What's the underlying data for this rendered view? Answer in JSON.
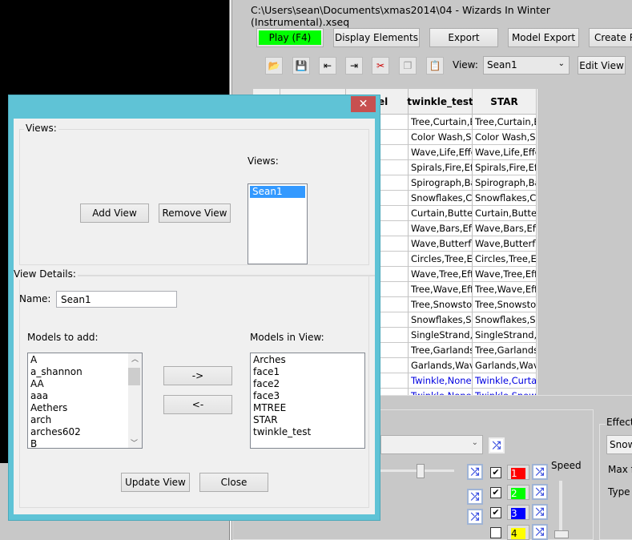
{
  "app": {
    "title": "C:\\Users\\sean\\Documents\\xmas2014\\04 - Wizards In Winter (Instrumental).xseq",
    "buttons": {
      "play": "Play (F4)",
      "display_elements": "Display Elements",
      "export": "Export",
      "model_export": "Model Export",
      "create": "Create R"
    },
    "view_label": "View:",
    "view_value": "Sean1",
    "edit_view": "Edit View",
    "grid": {
      "headers": [
        "",
        "",
        "el",
        "twinkle_test",
        "STAR"
      ],
      "rows": [
        [
          "Tree,Curtain,Ef",
          "Tree,Curtain,Ef"
        ],
        [
          "Color Wash,Sn",
          "Color Wash,Sn"
        ],
        [
          "Wave,Life,Effe",
          "Wave,Life,Effe"
        ],
        [
          "Spirals,Fire,Effe",
          "Spirals,Fire,Effe"
        ],
        [
          "Spirograph,Bar",
          "Spirograph,Bar"
        ],
        [
          "Snowflakes,Cu",
          "Snowflakes,Cu"
        ],
        [
          "Curtain,Butterf",
          "Curtain,Butterf"
        ],
        [
          "Wave,Bars,Effe",
          "Wave,Bars,Effe"
        ],
        [
          "Wave,Butterfly",
          "Wave,Butterfly"
        ],
        [
          "Circles,Tree,Eff",
          "Circles,Tree,Eff"
        ],
        [
          "Wave,Tree,Effe",
          "Wave,Tree,Effe"
        ],
        [
          "Tree,Wave,Effe",
          "Tree,Wave,Effe"
        ],
        [
          "Tree,Snowstor",
          "Tree,Snowstor"
        ],
        [
          "Snowflakes,Sir",
          "Snowflakes,Sir"
        ],
        [
          "SingleStrand,S",
          "SingleStrand,S"
        ],
        [
          "Tree,Garlands,",
          "Tree,Garlands,"
        ],
        [
          "Garlands,Wave",
          "Garlands,Wave"
        ],
        [
          "Twinkle,None,",
          "Twinkle,Curtai"
        ],
        [
          "Twinkle,None,",
          "Twinkle,Snowf"
        ]
      ],
      "blue_rows_from": 17
    },
    "bottom": {
      "speed": "Speed",
      "effect": "Effect",
      "effect_value": "Snow",
      "max": "Max f",
      "type": "Type",
      "palette": [
        {
          "label": "1",
          "color": "#ff0000",
          "checked": true
        },
        {
          "label": "2",
          "color": "#00ff00",
          "checked": true
        },
        {
          "label": "3",
          "color": "#0000ff",
          "checked": true
        },
        {
          "label": "4",
          "color": "#ffff00",
          "checked": false
        }
      ]
    }
  },
  "dialog": {
    "close": "✕",
    "views_group": "Views:",
    "add_view": "Add View",
    "remove_view": "Remove View",
    "views_label": "Views:",
    "views": [
      "Sean1"
    ],
    "details_group": "View Details:",
    "name_label": "Name:",
    "name_value": "Sean1",
    "models_to_add_label": "Models to add:",
    "models_to_add": [
      "A",
      "a_shannon",
      "AA",
      "aaa",
      "Aethers",
      "arch",
      "arches602",
      "B"
    ],
    "models_in_view_label": "Models in View:",
    "models_in_view": [
      "Arches",
      "face1",
      "face2",
      "face3",
      "MTREE",
      "STAR",
      "twinkle_test"
    ],
    "add_arrow": "->",
    "remove_arrow": "<-",
    "update_view": "Update View",
    "close_button": "Close"
  }
}
